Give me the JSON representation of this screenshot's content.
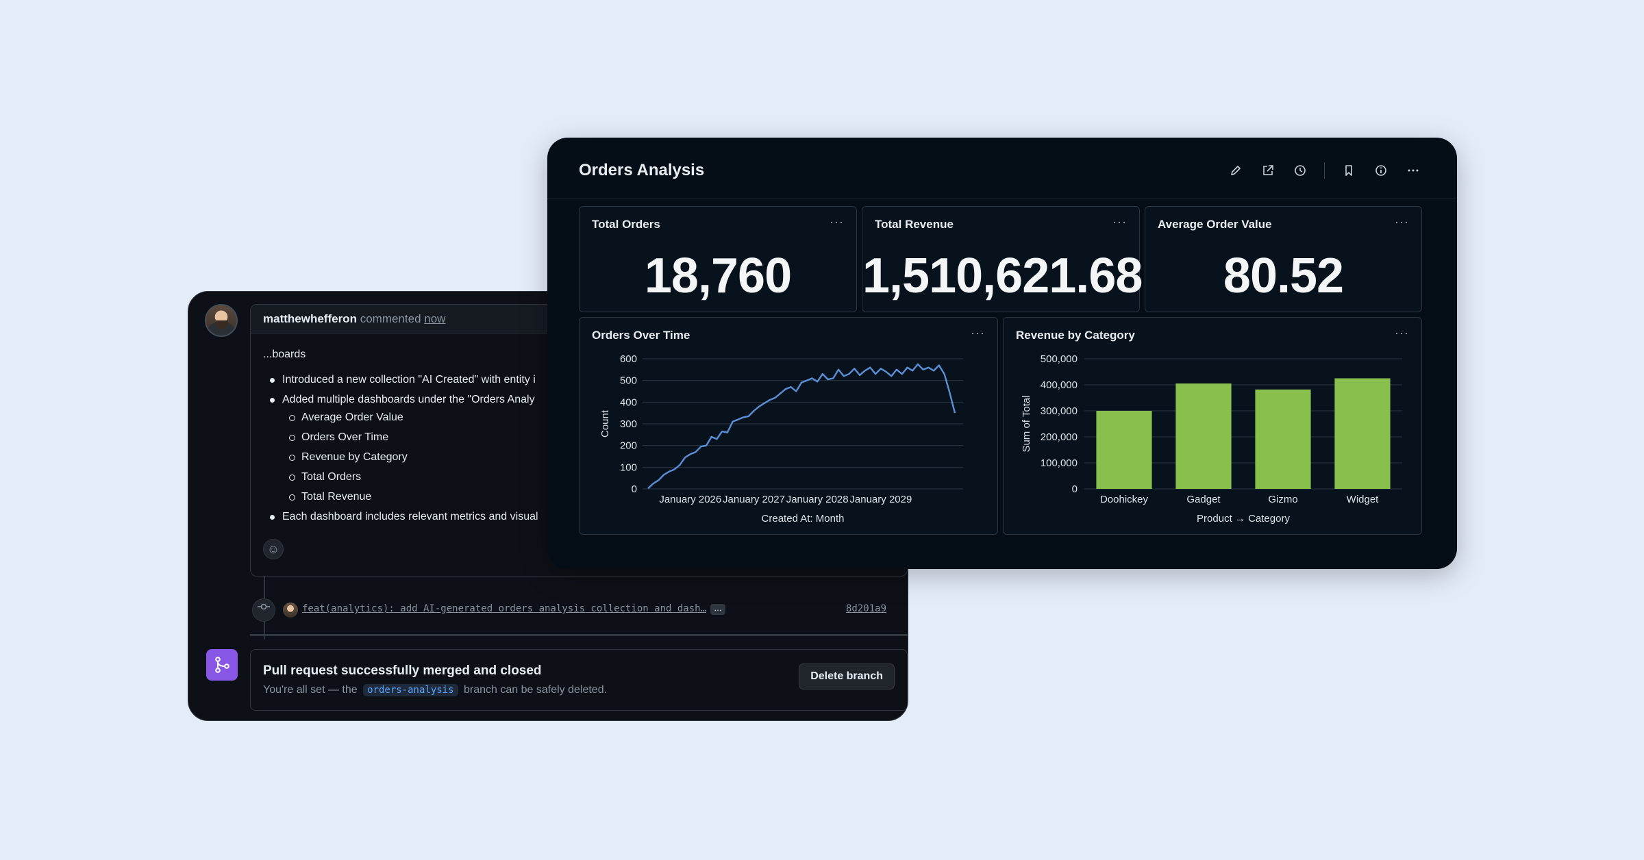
{
  "github": {
    "comment": {
      "author": "matthewhefferon",
      "action": "commented",
      "time": "now",
      "heading": "...boards",
      "bullets": [
        "Introduced a new collection \"AI Created\" with entity i",
        "Added multiple dashboards under the \"Orders Analy"
      ],
      "sub_items": [
        "Average Order Value",
        "Orders Over Time",
        "Revenue by Category",
        "Total Orders",
        "Total Revenue"
      ],
      "last_bullet": "Each dashboard includes relevant metrics and visual"
    },
    "commit": {
      "message": "feat(analytics): add AI-generated orders analysis collection and dash…",
      "more": "…",
      "sha": "8d201a9"
    },
    "merge": {
      "title": "Pull request successfully merged and closed",
      "sub_before": "You're all set — the",
      "branch": "orders-analysis",
      "sub_after": "branch can be safely deleted.",
      "delete_label": "Delete branch"
    }
  },
  "dashboard": {
    "title": "Orders Analysis",
    "more_glyph": "···",
    "kpis": [
      {
        "title": "Total Orders",
        "value": "18,760"
      },
      {
        "title": "Total Revenue",
        "value": "1,510,621.68"
      },
      {
        "title": "Average Order Value",
        "value": "80.52"
      }
    ],
    "line_card": {
      "title": "Orders Over Time"
    },
    "bar_card": {
      "title": "Revenue by Category"
    }
  },
  "colors": {
    "line": "#5b8fd6",
    "bar": "#88bf4d"
  },
  "chart_data": [
    {
      "type": "line",
      "title": "Orders Over Time",
      "xlabel": "Created At: Month",
      "ylabel": "Count",
      "ylim": [
        0,
        600
      ],
      "yticks": [
        0,
        100,
        200,
        300,
        400,
        500,
        600
      ],
      "xticks": [
        "January 2026",
        "January 2027",
        "January 2028",
        "January 2029"
      ],
      "x_start": "2025-05",
      "values": [
        2,
        25,
        40,
        65,
        80,
        90,
        110,
        145,
        160,
        170,
        195,
        200,
        240,
        230,
        265,
        260,
        310,
        320,
        330,
        335,
        360,
        380,
        395,
        410,
        420,
        440,
        460,
        470,
        450,
        490,
        500,
        510,
        495,
        530,
        505,
        510,
        550,
        520,
        530,
        555,
        525,
        545,
        560,
        530,
        555,
        540,
        520,
        550,
        530,
        560,
        545,
        575,
        550,
        560,
        545,
        570,
        530,
        445,
        350
      ],
      "grid": true
    },
    {
      "type": "bar",
      "title": "Revenue by Category",
      "xlabel": "Product → Category",
      "ylabel": "Sum of Total",
      "categories": [
        "Doohickey",
        "Gadget",
        "Gizmo",
        "Widget"
      ],
      "values": [
        300000,
        405000,
        382000,
        425000
      ],
      "ylim": [
        0,
        500000
      ],
      "yticks": [
        "0",
        "100,000",
        "200,000",
        "300,000",
        "400,000",
        "500,000"
      ],
      "grid": true
    }
  ]
}
